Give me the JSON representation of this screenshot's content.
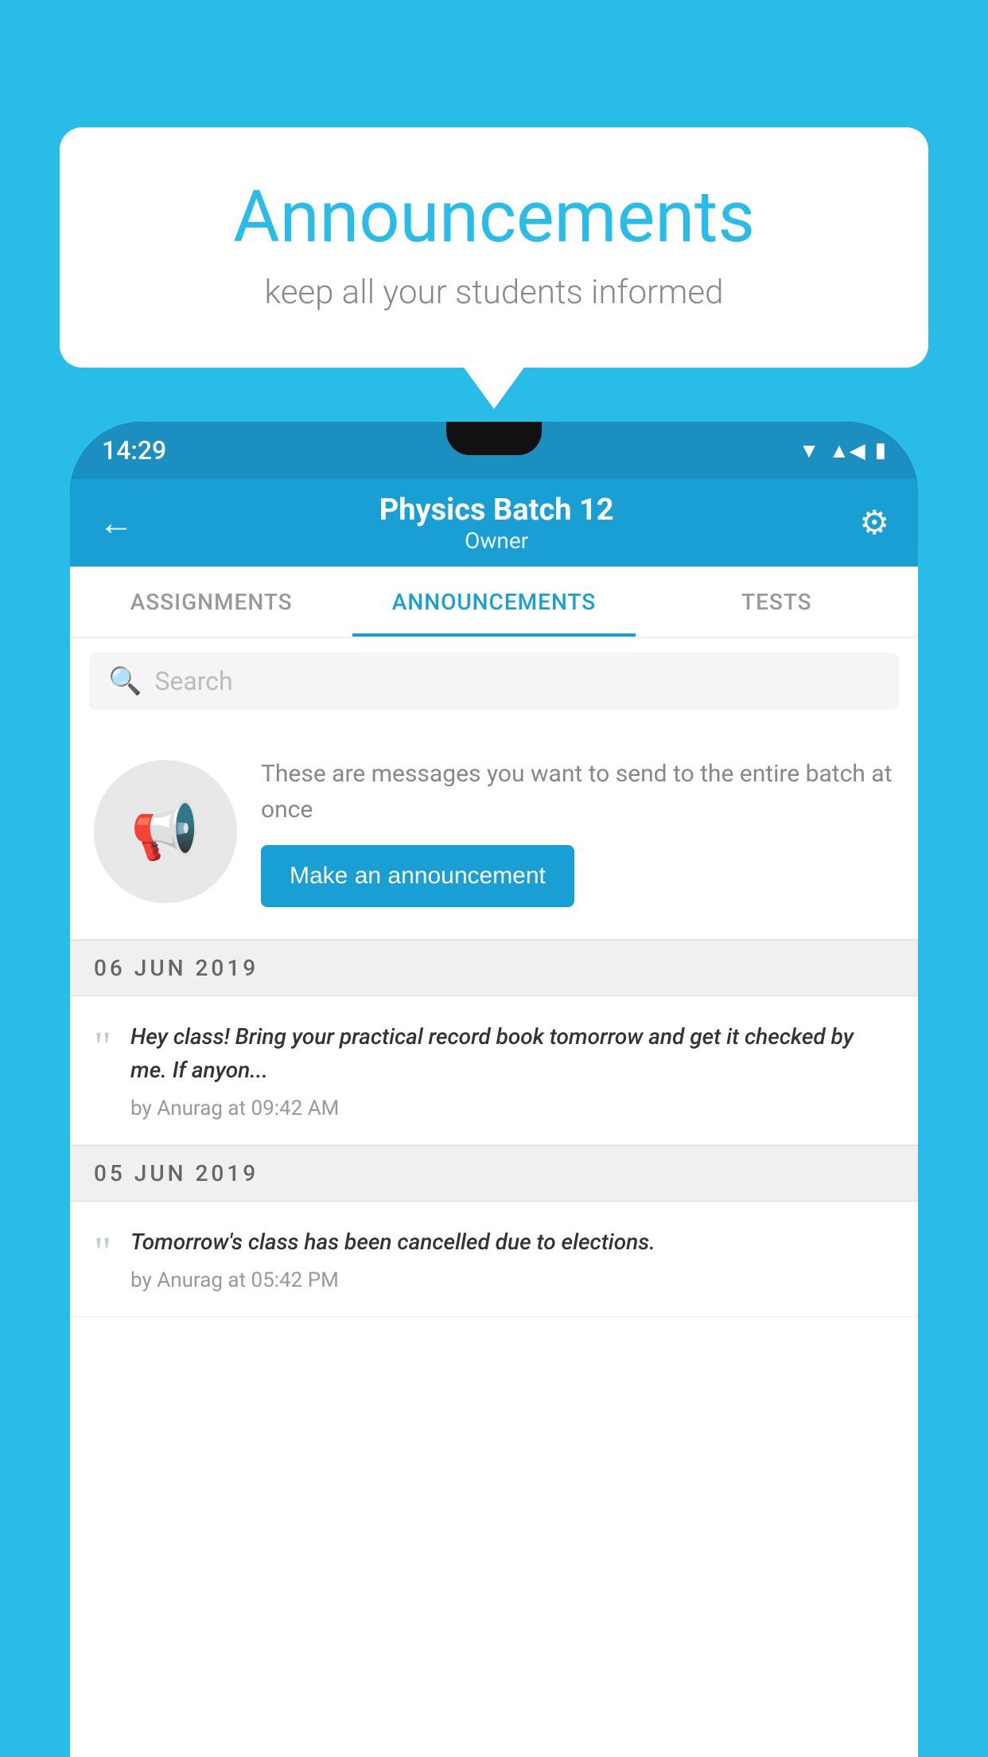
{
  "background_color": "#29bce8",
  "speech_bubble": {
    "title": "Announcements",
    "subtitle": "keep all your students informed"
  },
  "phone": {
    "status_bar": {
      "time": "14:29",
      "icons": [
        "wifi",
        "signal",
        "battery"
      ]
    },
    "app_bar": {
      "title": "Physics Batch 12",
      "subtitle": "Owner",
      "back_icon": "←",
      "settings_icon": "⚙"
    },
    "tabs": [
      {
        "label": "ASSIGNMENTS",
        "active": false
      },
      {
        "label": "ANNOUNCEMENTS",
        "active": true
      },
      {
        "label": "TESTS",
        "active": false
      }
    ],
    "search": {
      "placeholder": "Search"
    },
    "announcement_prompt": {
      "description": "These are messages you want to send to the entire batch at once",
      "button_label": "Make an announcement"
    },
    "announcements": [
      {
        "date": "06  JUN  2019",
        "text": "Hey class! Bring your practical record book tomorrow and get it checked by me. If anyon...",
        "meta": "by Anurag at 09:42 AM"
      },
      {
        "date": "05  JUN  2019",
        "text": "Tomorrow's class has been cancelled due to elections.",
        "meta": "by Anurag at 05:42 PM"
      }
    ]
  }
}
